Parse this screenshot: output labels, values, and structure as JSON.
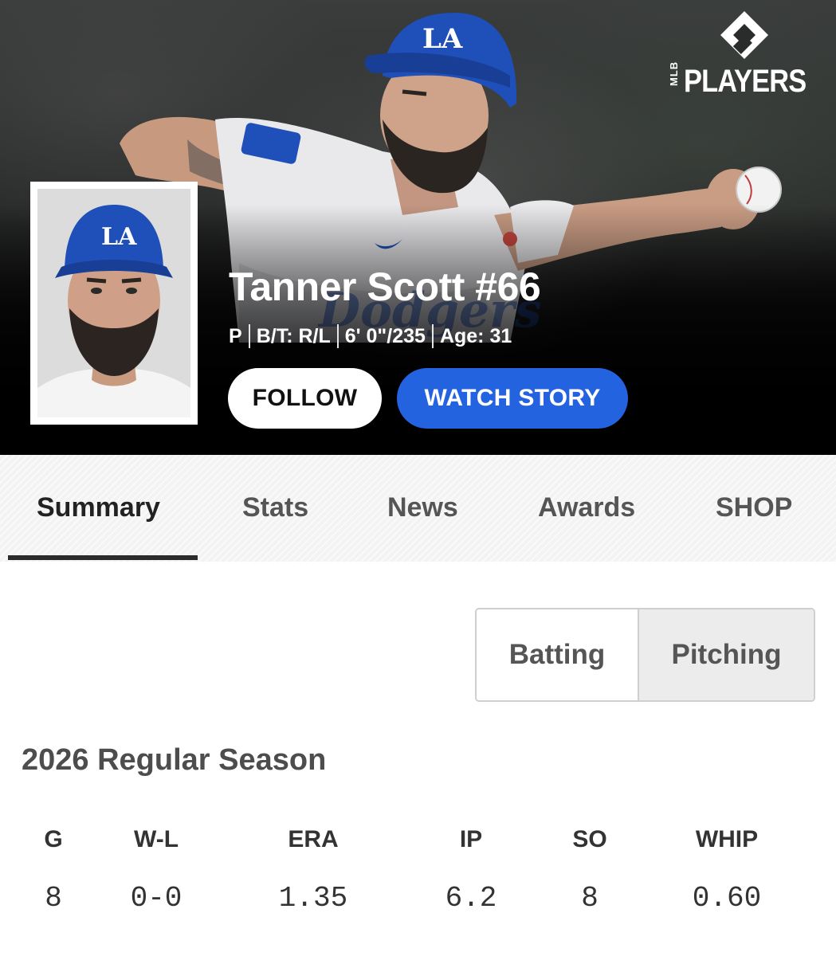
{
  "hero": {
    "brand": {
      "mlb": "MLB",
      "players": "PLAYERS"
    },
    "player_name": "Tanner Scott #66",
    "meta": {
      "position": "P",
      "bats_throws": "B/T: R/L",
      "height_weight": "6' 0\"/235",
      "age": "Age: 31"
    },
    "follow_label": "FOLLOW",
    "watch_story_label": "WATCH STORY"
  },
  "tabs": [
    "Summary",
    "Stats",
    "News",
    "Awards",
    "SHOP"
  ],
  "active_tab": "Summary",
  "stat_toggle": {
    "batting_label": "Batting",
    "pitching_label": "Pitching",
    "selected": "Pitching"
  },
  "season_title": "2026 Regular Season",
  "stats": {
    "headers": [
      "G",
      "W-L",
      "ERA",
      "IP",
      "SO",
      "WHIP"
    ],
    "values": [
      "8",
      "0-0",
      "1.35",
      "6.2",
      "8",
      "0.60"
    ]
  },
  "colors": {
    "accent_blue": "#2463e0",
    "cap_blue": "#1f4fb8",
    "hero_bg": "#000000"
  },
  "icons": {
    "brand_mark": "mlb-players-diamond-logo"
  }
}
